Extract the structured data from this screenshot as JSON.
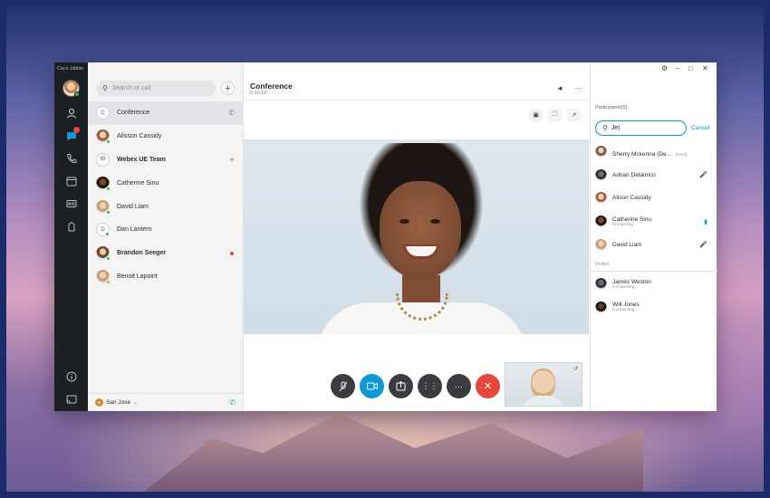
{
  "app": {
    "title": "Cisco Jabber"
  },
  "search": {
    "placeholder": "Search or call"
  },
  "contacts": [
    {
      "letter": "C",
      "name": "Conference",
      "bold": false,
      "active": true
    },
    {
      "name": "Alisson Cassidy",
      "status": "online"
    },
    {
      "letter": "W",
      "name": "Webex UE Team",
      "bold": true,
      "unread": "soft"
    },
    {
      "name": "Catherine Sinu",
      "status": "online"
    },
    {
      "name": "David Liam",
      "status": "online"
    },
    {
      "letter": "D",
      "name": "Dan Lantern",
      "status": "online"
    },
    {
      "name": "Brandon Seeger",
      "bold": true,
      "unread": "red"
    },
    {
      "name": "Benoit Lapoint",
      "status": "away"
    }
  ],
  "footer": {
    "location": "San Jose"
  },
  "conversation": {
    "title": "Conference",
    "duration": "0:10:12"
  },
  "participants": {
    "title": "Participants(5)",
    "search_value": "Je|",
    "cancel_label": "Cancel",
    "list": [
      {
        "name": "Sherry Mckenna (De...",
        "tag": "(Host)"
      },
      {
        "name": "Adrian Delamico",
        "mic": "muted"
      },
      {
        "name": "Alison Cassidy"
      },
      {
        "name": "Catherine Sinu",
        "sub": "Presenting",
        "mic": "active"
      },
      {
        "name": "David Liam",
        "mic": "muted"
      }
    ],
    "invited_label": "Invited",
    "invited": [
      {
        "name": "James Weston",
        "sub": "Connecting..."
      },
      {
        "name": "Will Jones",
        "sub": "Connecting..."
      }
    ]
  },
  "colors": {
    "accent": "#0b9ad6",
    "end_call": "#e8463a",
    "rail": "#1c1f24",
    "online": "#3cb34a"
  },
  "icons": [
    "contacts-icon",
    "chat-icon",
    "calls-icon",
    "meetings-icon",
    "voicemail-icon",
    "custom-tab-icon",
    "help-icon",
    "cast-icon"
  ]
}
